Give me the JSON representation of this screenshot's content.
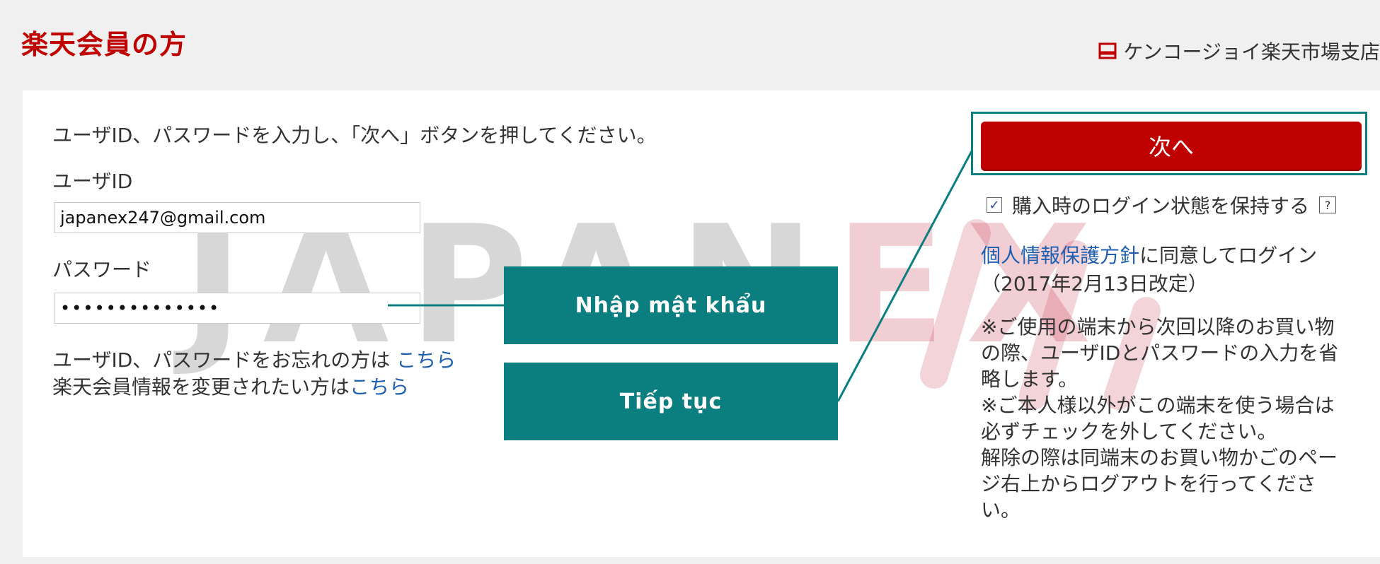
{
  "header": {
    "title": "楽天会員の方",
    "shop_name": "ケンコージョイ楽天市場支店",
    "shop_icon": "shop-icon"
  },
  "form": {
    "instruction": "ユーザID、パスワードを入力し、「次へ」ボタンを押してください。",
    "userid_label": "ユーザID",
    "userid_value": "japanex247@gmail.com",
    "password_label": "パスワード",
    "password_value": "••••••••••••••",
    "forgot_text": "ユーザID、パスワードをお忘れの方は ",
    "forgot_link": "こちら",
    "change_text": "楽天会員情報を変更されたい方は",
    "change_link": "こちら"
  },
  "side": {
    "next_button": "次へ",
    "keep_login_label": "購入時のログイン状態を保持する",
    "keep_login_checked": true,
    "help_icon": "?",
    "privacy_link": "個人情報保護方針",
    "privacy_text": "に同意してログイン",
    "privacy_date": "（2017年2月13日改定）",
    "notes": [
      "※ご使用の端末から次回以降のお買い物の際、ユーザIDとパスワードの入力を省略します。",
      "※ご本人様以外がこの端末を使う場合は必ずチェックを外してください。",
      "解除の際は同端末のお買い物かごのページ右上からログアウトを行ってください。"
    ]
  },
  "annotations": {
    "callout_password": "Nhập mật khẩu",
    "callout_next": "Tiếp tục",
    "color": "#0b7f80"
  },
  "watermark": {
    "part_a": "JAPAN",
    "part_b": "EX"
  },
  "colors": {
    "brand_red": "#bf0000",
    "link_blue": "#1f5fb0",
    "teal": "#0b7f80"
  }
}
